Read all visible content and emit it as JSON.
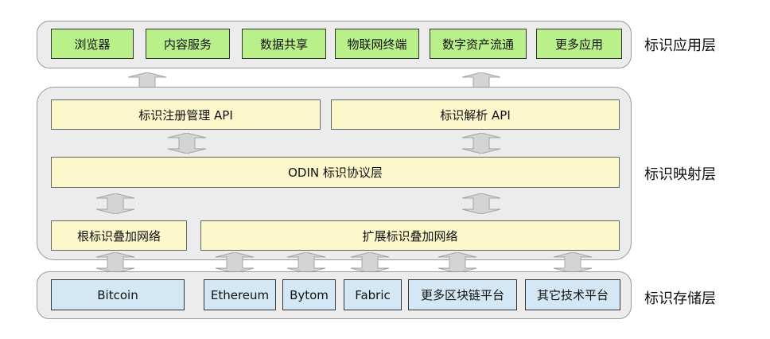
{
  "app_layer": {
    "label": "标识应用层",
    "items": [
      "浏览器",
      "内容服务",
      "数据共享",
      "物联网终端",
      "数字资产流通",
      "更多应用"
    ]
  },
  "mapping_layer": {
    "label": "标识映射层",
    "register_api": "标识注册管理 API",
    "resolve_api": "标识解析 API",
    "protocol": "ODIN 标识协议层",
    "root_network": "根标识叠加网络",
    "ext_network": "扩展标识叠加网络"
  },
  "storage_layer": {
    "label": "标识存储层",
    "items": [
      "Bitcoin",
      "Ethereum",
      "Bytom",
      "Fabric",
      "更多区块链平台",
      "其它技术平台"
    ]
  },
  "colors": {
    "app_box": "#b9f08a",
    "mapping_box": "#fdf7cc",
    "storage_box": "#d3e8f4",
    "layer_bg": "#ececec",
    "arrow": "#d4d4d4"
  }
}
